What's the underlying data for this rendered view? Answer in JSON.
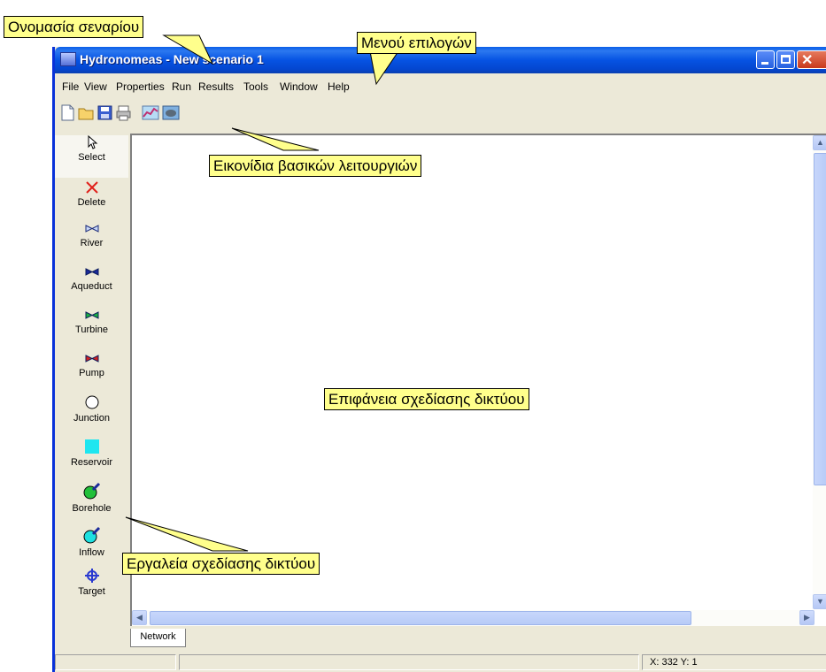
{
  "window": {
    "title": "Hydronomeas - New scenario 1",
    "controls": {
      "minimize": "minimize",
      "maximize": "maximize",
      "close": "close"
    }
  },
  "menu": [
    "File",
    "View",
    "Properties",
    "Run",
    "Results",
    "Tools",
    "Window",
    "Help"
  ],
  "toolbar": {
    "buttons": [
      "new-file-icon",
      "open-folder-icon",
      "save-icon",
      "print-icon",
      "chart-icon",
      "network-icon"
    ]
  },
  "tools": [
    {
      "label": "Select",
      "icon": "pointer-icon"
    },
    {
      "label": "Delete",
      "icon": "red-x-icon"
    },
    {
      "label": "River",
      "icon": "river-link-icon"
    },
    {
      "label": "Aqueduct",
      "icon": "aqueduct-link-icon"
    },
    {
      "label": "Turbine",
      "icon": "turbine-link-icon"
    },
    {
      "label": "Pump",
      "icon": "pump-link-icon"
    },
    {
      "label": "Junction",
      "icon": "junction-circle-icon"
    },
    {
      "label": "Reservoir",
      "icon": "reservoir-square-icon"
    },
    {
      "label": "Borehole",
      "icon": "borehole-icon"
    },
    {
      "label": "Inflow",
      "icon": "inflow-icon"
    },
    {
      "label": "Target",
      "icon": "target-crosshair-icon"
    }
  ],
  "tabs": [
    "Network"
  ],
  "status": {
    "coords": "X: 332 Y: 1"
  },
  "annotations": {
    "scenario_name": "Ονομασία σεναρίου",
    "options_menu": "Μενού επιλογών",
    "basic_icons": "Εικονίδια βασικών λειτουργιών",
    "drawing_surface": "Επιφάνεια σχεδίασης δικτύου",
    "drawing_tools": "Εργαλεία σχεδίασης δικτύου"
  },
  "colors": {
    "titlebar": "#0653e3",
    "callout": "#ffff8c",
    "reservoir": "#1ee6f0",
    "delete": "#e0201a"
  }
}
